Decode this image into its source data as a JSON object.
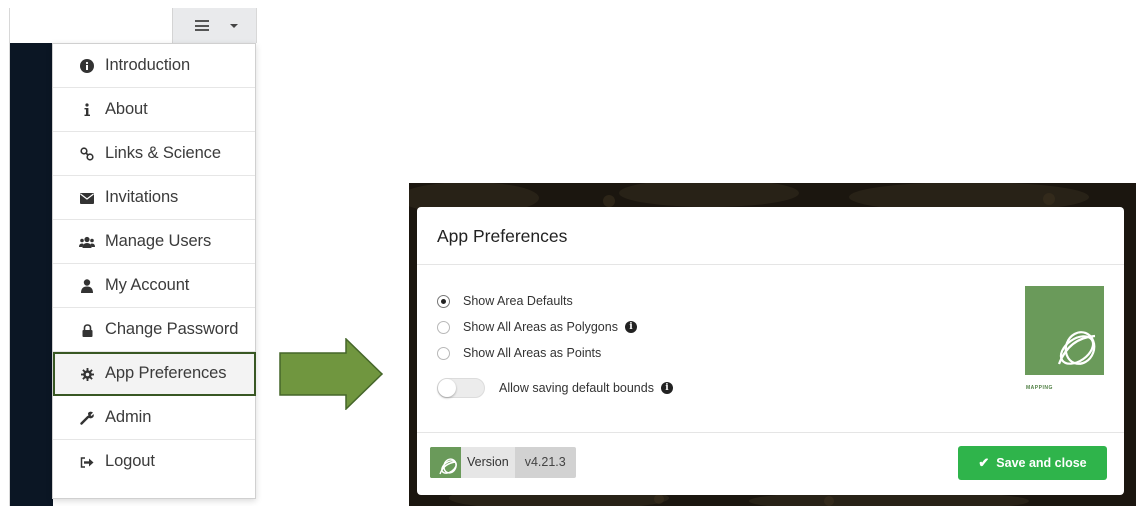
{
  "menu": {
    "items": [
      {
        "label": "Introduction",
        "icon": "info-circle-icon"
      },
      {
        "label": "About",
        "icon": "info-icon"
      },
      {
        "label": "Links & Science",
        "icon": "link-icon"
      },
      {
        "label": "Invitations",
        "icon": "envelope-icon"
      },
      {
        "label": "Manage Users",
        "icon": "users-icon"
      },
      {
        "label": "My Account",
        "icon": "user-icon"
      },
      {
        "label": "Change Password",
        "icon": "lock-icon"
      },
      {
        "label": "App Preferences",
        "icon": "gear-icon",
        "active": true
      },
      {
        "label": "Admin",
        "icon": "wrench-icon"
      },
      {
        "label": "Logout",
        "icon": "sign-out-icon"
      }
    ]
  },
  "modal": {
    "title": "App Preferences",
    "options": [
      {
        "label": "Show Area Defaults",
        "selected": true
      },
      {
        "label": "Show All Areas as Polygons",
        "selected": false,
        "info": true
      },
      {
        "label": "Show All Areas as Points",
        "selected": false
      }
    ],
    "toggle": {
      "label": "Allow saving default bounds",
      "on": false
    },
    "logo_text": "MAPPING",
    "version_label": "Version",
    "version_value": "v4.21.3",
    "save_label": "Save and close"
  },
  "colors": {
    "accent_green": "#2fb44b",
    "highlight_border": "#385723",
    "arrow_green": "#70963f",
    "logo_green": "#6a9a5a",
    "sidebar_dark": "#0b1624"
  }
}
